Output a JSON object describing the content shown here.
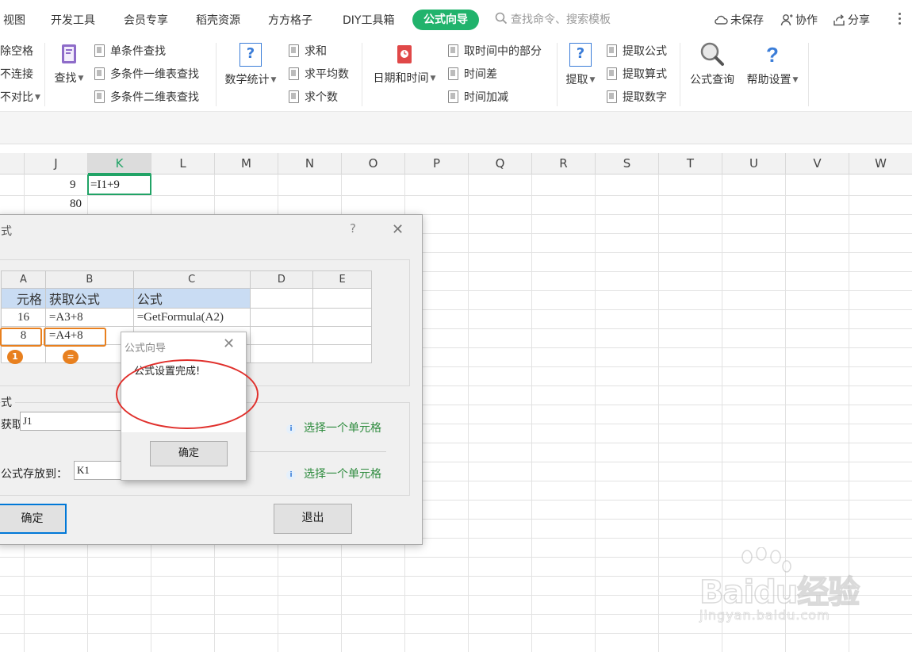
{
  "menubar": {
    "tabs": [
      "视图",
      "开发工具",
      "会员专享",
      "稻壳资源",
      "方方格子",
      "DIY工具箱",
      "公式向导"
    ],
    "active_tab": "公式向导",
    "search_placeholder": "查找命令、搜索模板",
    "unsaved_label": "未保存",
    "collab_label": "协作",
    "share_label": "分享"
  },
  "ribbon": {
    "left_partial": [
      "除空格",
      "不连接",
      "不对比"
    ],
    "lookup": {
      "label": "查找",
      "items": [
        "单条件查找",
        "多条件一维表查找",
        "多条件二维表查找"
      ]
    },
    "math": {
      "label": "数学统计",
      "items": [
        "求和",
        "求平均数",
        "求个数"
      ]
    },
    "datetime": {
      "label": "日期和时间",
      "items": [
        "取时间中的部分",
        "时间差",
        "时间加减"
      ]
    },
    "extract": {
      "label": "提取",
      "items": [
        "提取公式",
        "提取算式",
        "提取数字"
      ]
    },
    "formula_query": "公式查询",
    "help_settings": "帮助设置"
  },
  "sheet": {
    "columns": [
      "J",
      "K",
      "L",
      "M",
      "N",
      "O",
      "P",
      "Q",
      "R",
      "S",
      "T",
      "U",
      "V",
      "W"
    ],
    "selected_column": "K",
    "j1": "9",
    "k1": "=I1+9",
    "j2": "80"
  },
  "dialog": {
    "title": "式",
    "help": "?",
    "example": {
      "headers": [
        "A",
        "B",
        "C",
        "D",
        "E"
      ],
      "row1": [
        "元格",
        "获取公式",
        "公式"
      ],
      "row2": [
        "16",
        "=A3+8",
        "=GetFormula(A2)"
      ],
      "row3": [
        "8",
        "=A4+8"
      ],
      "badge1": "1",
      "badge2": "="
    },
    "group_legend": "式",
    "source_label": "获取",
    "source_value": "J1",
    "source_hint": "选择一个单元格",
    "dest_label": "公式存放到：",
    "dest_value": "K1",
    "dest_hint": "选择一个单元格",
    "ok_button": "确定",
    "exit_button": "退出"
  },
  "popup": {
    "title": "公式向导",
    "message": "公式设置完成!",
    "ok_button": "确定"
  },
  "watermark": {
    "main": "Baidu经验",
    "sub": "jingyan.baidu.com"
  },
  "colors": {
    "accent_green": "#21b36c",
    "highlight_orange": "#e8801f",
    "annotation_red": "#e0302c",
    "header_blue": "#c9dcf3"
  }
}
